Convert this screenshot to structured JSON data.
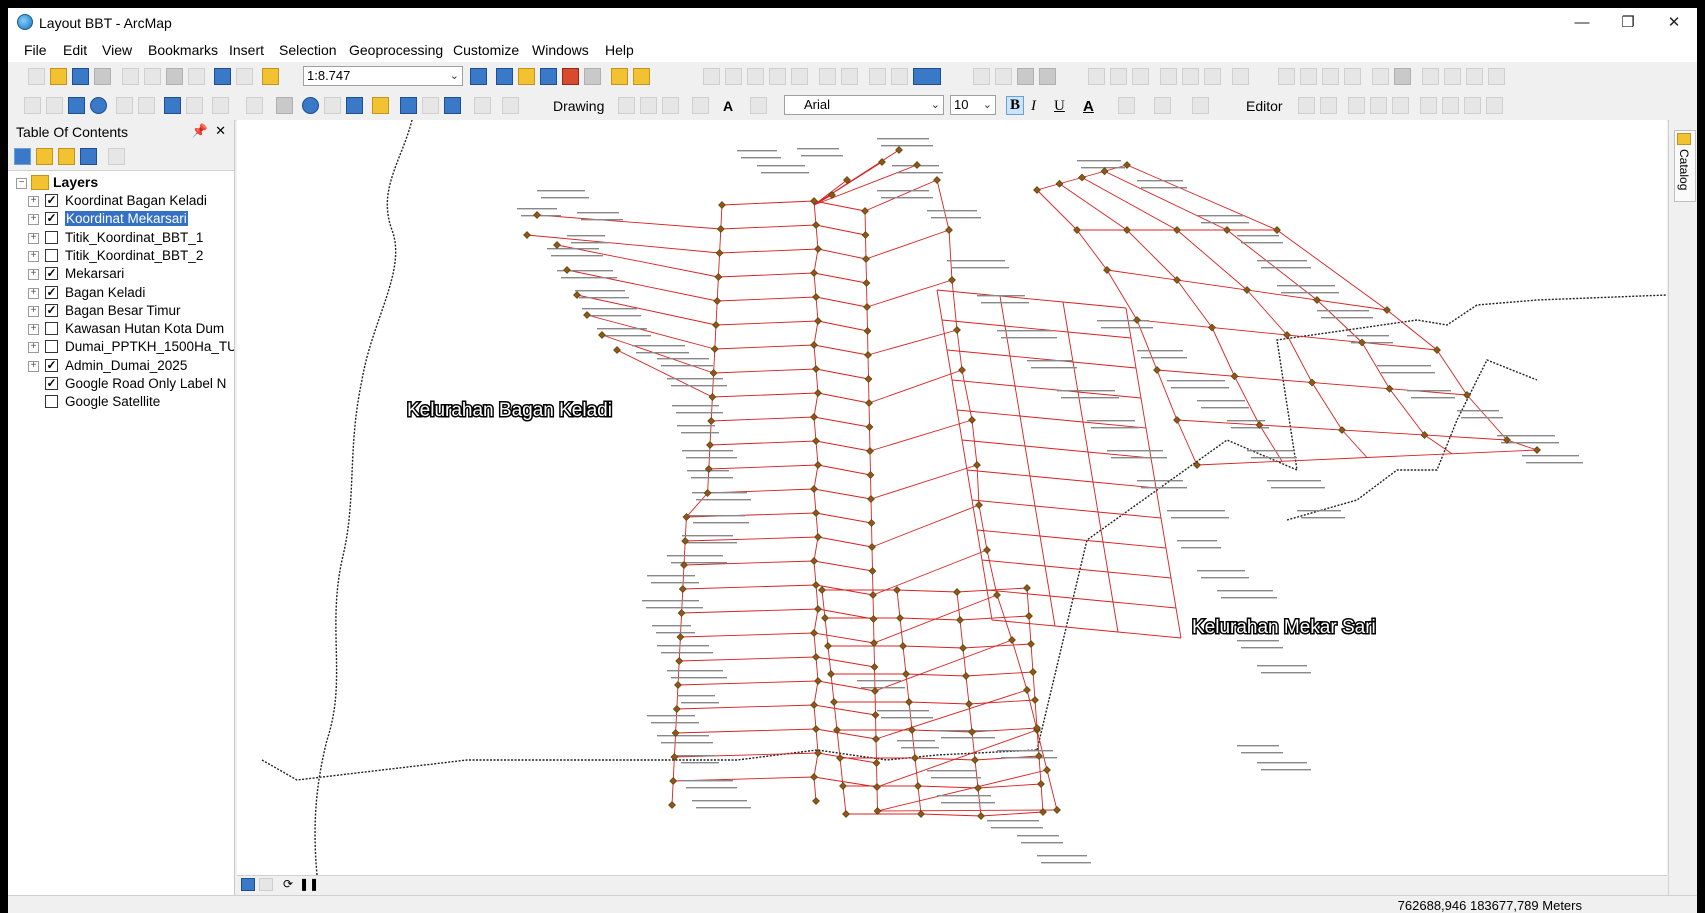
{
  "window": {
    "title": "Layout BBT - ArcMap"
  },
  "menu": [
    "File",
    "Edit",
    "View",
    "Bookmarks",
    "Insert",
    "Selection",
    "Geoprocessing",
    "Customize",
    "Windows",
    "Help"
  ],
  "toolbar": {
    "scale": "1:8.747",
    "drawing_label": "Drawing",
    "font_name": "Arial",
    "font_size": "10",
    "bold": "B",
    "italic": "I",
    "underline": "U",
    "font_color_icon": "A",
    "editor_label": "Editor"
  },
  "toc": {
    "title": "Table Of Contents",
    "root": "Layers",
    "layers": [
      {
        "name": "Koordinat Bagan Keladi",
        "checked": true,
        "expandable": true,
        "selected": false
      },
      {
        "name": "Koordinat Mekarsari",
        "checked": true,
        "expandable": true,
        "selected": true
      },
      {
        "name": "Titik_Koordinat_BBT_1",
        "checked": false,
        "expandable": true,
        "selected": false
      },
      {
        "name": "Titik_Koordinat_BBT_2",
        "checked": false,
        "expandable": true,
        "selected": false
      },
      {
        "name": "Mekarsari",
        "checked": true,
        "expandable": true,
        "selected": false
      },
      {
        "name": "Bagan Keladi",
        "checked": true,
        "expandable": true,
        "selected": false
      },
      {
        "name": "Bagan Besar Timur",
        "checked": true,
        "expandable": true,
        "selected": false
      },
      {
        "name": "Kawasan Hutan Kota Dum",
        "checked": false,
        "expandable": true,
        "selected": false
      },
      {
        "name": "Dumai_PPTKH_1500Ha_TU",
        "checked": false,
        "expandable": true,
        "selected": false
      },
      {
        "name": "Admin_Dumai_2025",
        "checked": true,
        "expandable": true,
        "selected": false
      },
      {
        "name": "Google Road Only Label N",
        "checked": true,
        "expandable": false,
        "selected": false
      },
      {
        "name": "Google Satellite",
        "checked": false,
        "expandable": false,
        "selected": false
      }
    ]
  },
  "map": {
    "labels": {
      "bagan_keladi": "Kelurahan Bagan Keladi",
      "mekar_sari": "Kelurahan Mekar Sari"
    },
    "parcel_color": "#d92020",
    "point_color": "#8b5a14",
    "boundary_color": "#222222"
  },
  "side": {
    "catalog": "Catalog"
  },
  "status": {
    "coords": "762688,946  183677,789 Meters"
  }
}
